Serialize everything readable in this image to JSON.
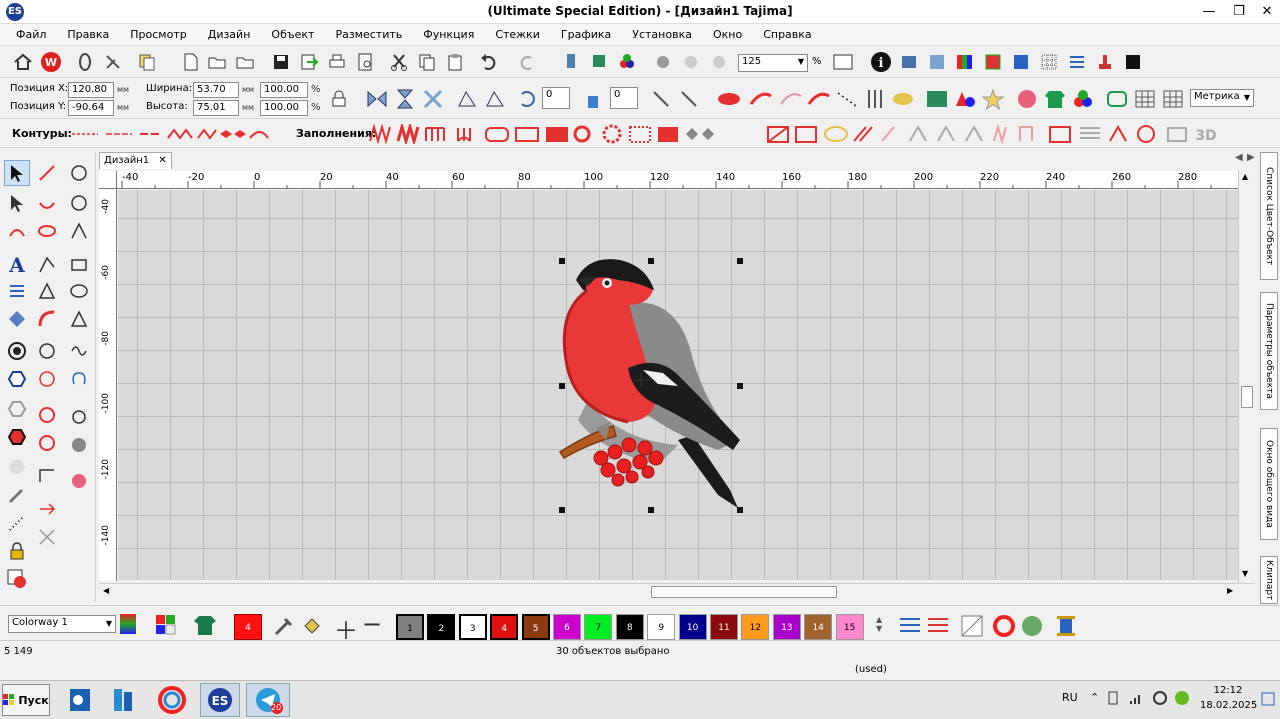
{
  "window": {
    "title": "(Ultimate Special Edition) - [Дизайн1       Tajima]",
    "app_icon": "ES"
  },
  "menu": [
    "Файл",
    "Правка",
    "Просмотр",
    "Дизайн",
    "Объект",
    "Разместить",
    "Функция",
    "Стежки",
    "Графика",
    "Установка",
    "Окно",
    "Справка"
  ],
  "toolbar1": {
    "zoom_value": "125",
    "zoom_unit": "%"
  },
  "props": {
    "pos_x_label": "Позиция X:",
    "pos_x": "120.80",
    "pos_y_label": "Позиция Y:",
    "pos_y": "-90.64",
    "width_label": "Ширина:",
    "width": "53.70",
    "height_label": "Высота:",
    "height": "75.01",
    "unit_mm": "мм",
    "scale_w": "100.00",
    "scale_h": "100.00",
    "pct": "%",
    "rot1": "0",
    "rot2": "0",
    "units_select": "Метрика"
  },
  "toolbar3": {
    "contours_label": "Контуры:",
    "fills_label": "Заполнения:",
    "three_d": "3D"
  },
  "tab": {
    "label": "Дизайн1",
    "close": "✕"
  },
  "ruler_h": [
    "-40",
    "-20",
    "0",
    "20",
    "40",
    "60",
    "80",
    "100",
    "120",
    "140",
    "160",
    "180",
    "200",
    "220",
    "240",
    "260",
    "280"
  ],
  "ruler_v": [
    "-40",
    "-60",
    "-80",
    "-100",
    "-120",
    "-140"
  ],
  "right_tabs": [
    "Список Цвет-Объект",
    "Параметры объекта",
    "Окно общего вида",
    "Клипарт"
  ],
  "colorway": {
    "label": "Colorway 1"
  },
  "swatches_a": [
    {
      "n": "4",
      "c": "#ff0000",
      "t": "#fff"
    }
  ],
  "swatches_b": [
    {
      "n": "1",
      "c": "#808080",
      "t": "#000"
    },
    {
      "n": "2",
      "c": "#000000",
      "t": "#fff"
    },
    {
      "n": "3",
      "c": "#ffffff",
      "t": "#000"
    },
    {
      "n": "4",
      "c": "#e01010",
      "t": "#fff"
    },
    {
      "n": "5",
      "c": "#8b3a10",
      "t": "#fff"
    },
    {
      "n": "6",
      "c": "#cc00cc",
      "t": "#fff"
    },
    {
      "n": "7",
      "c": "#00ee22",
      "t": "#000"
    },
    {
      "n": "8",
      "c": "#000000",
      "t": "#fff"
    },
    {
      "n": "9",
      "c": "#ffffff",
      "t": "#000"
    },
    {
      "n": "10",
      "c": "#00008b",
      "t": "#fff"
    },
    {
      "n": "11",
      "c": "#8b0a0a",
      "t": "#fff"
    },
    {
      "n": "12",
      "c": "#ff9a1a",
      "t": "#000"
    },
    {
      "n": "13",
      "c": "#aa00cc",
      "t": "#fff"
    },
    {
      "n": "14",
      "c": "#a0622c",
      "t": "#fff"
    },
    {
      "n": "15",
      "c": "#ff88cc",
      "t": "#000"
    }
  ],
  "status": {
    "left": "5 149",
    "center": "30 объектов выбрано",
    "used": "(used)"
  },
  "taskbar": {
    "start": "Пуск",
    "lang": "RU",
    "time": "12:12",
    "date": "18.02.2025",
    "telegram_badge": "20"
  }
}
